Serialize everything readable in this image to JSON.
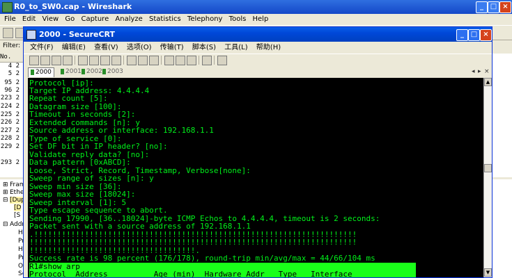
{
  "wireshark": {
    "title": "R0_to_SW0.cap - Wireshark",
    "menu": [
      "File",
      "Edit",
      "View",
      "Go",
      "Capture",
      "Analyze",
      "Statistics",
      "Telephony",
      "Tools",
      "Help"
    ],
    "filter_label": "Filter:",
    "no_header": "No.",
    "packets": [
      "4 2",
      "5 2",
      "95 2",
      "96 2",
      "223 2",
      "224 2",
      "225 2",
      "226 2",
      "227 2",
      "228 2",
      "229 2",
      "293 2"
    ],
    "detail": {
      "frame": "Fram",
      "ethernet": "Ethe",
      "dup": "[Dup",
      "dup_sub": "[D",
      "dup_sub2": "[S",
      "address": "Addr",
      "h1": "Ha",
      "h2": "Pr",
      "h3": "Ha",
      "h4": "Pr",
      "op": "Op",
      "s": "Se"
    }
  },
  "crt": {
    "title": "2000 - SecureCRT",
    "menu": [
      "文件(F)",
      "编辑(E)",
      "查看(V)",
      "选项(O)",
      "传输(T)",
      "脚本(S)",
      "工具(L)",
      "帮助(H)"
    ],
    "tabs": [
      "2000",
      "2001",
      "2002",
      "2003"
    ],
    "tab_close": "×",
    "lines": [
      "Protocol [ip]:",
      "Target IP address: 4.4.4.4",
      "Repeat count [5]:",
      "Datagram size [100]:",
      "Timeout in seconds [2]:",
      "Extended commands [n]: y",
      "Source address or interface: 192.168.1.1",
      "Type of service [0]:",
      "Set DF bit in IP header? [no]:",
      "Validate reply data? [no]:",
      "Data pattern [0xABCD]:",
      "Loose, Strict, Record, Timestamp, Verbose[none]:",
      "Sweep range of sizes [n]: y",
      "Sweep min size [36]:",
      "Sweep max size [18024]:",
      "Sweep interval [1]: 5",
      "Type escape sequence to abort.",
      "Sending 17990, [36..18024]-byte ICMP Echos to 4.4.4.4, timeout is 2 seconds:",
      "Packet sent with a source address of 192.168.1.1",
      ".!!!!!!!!!!!!!!!!!!!!!!!!!!!!!!!!!!!!!!!!!!!!!!!!!!!!!!!!!!!!!!!!!!!!!!",
      "!!!!!!!!!!!!!!!!!!!!!!!!!!!!!!!!!!!!!!!!!!!!!!!!!!!!!!!!!!!!!!!!!!!!!!!",
      "!!!!!!!!!!!!!!!!!!!!!!!!!!!!!!!!!!!!.",
      "Success rate is 98 percent (176/178), round-trip min/avg/max = 44/66/104 ms",
      "R1#show arp",
      "Protocol  Address          Age (min)  Hardware Addr   Type   Interface"
    ]
  }
}
